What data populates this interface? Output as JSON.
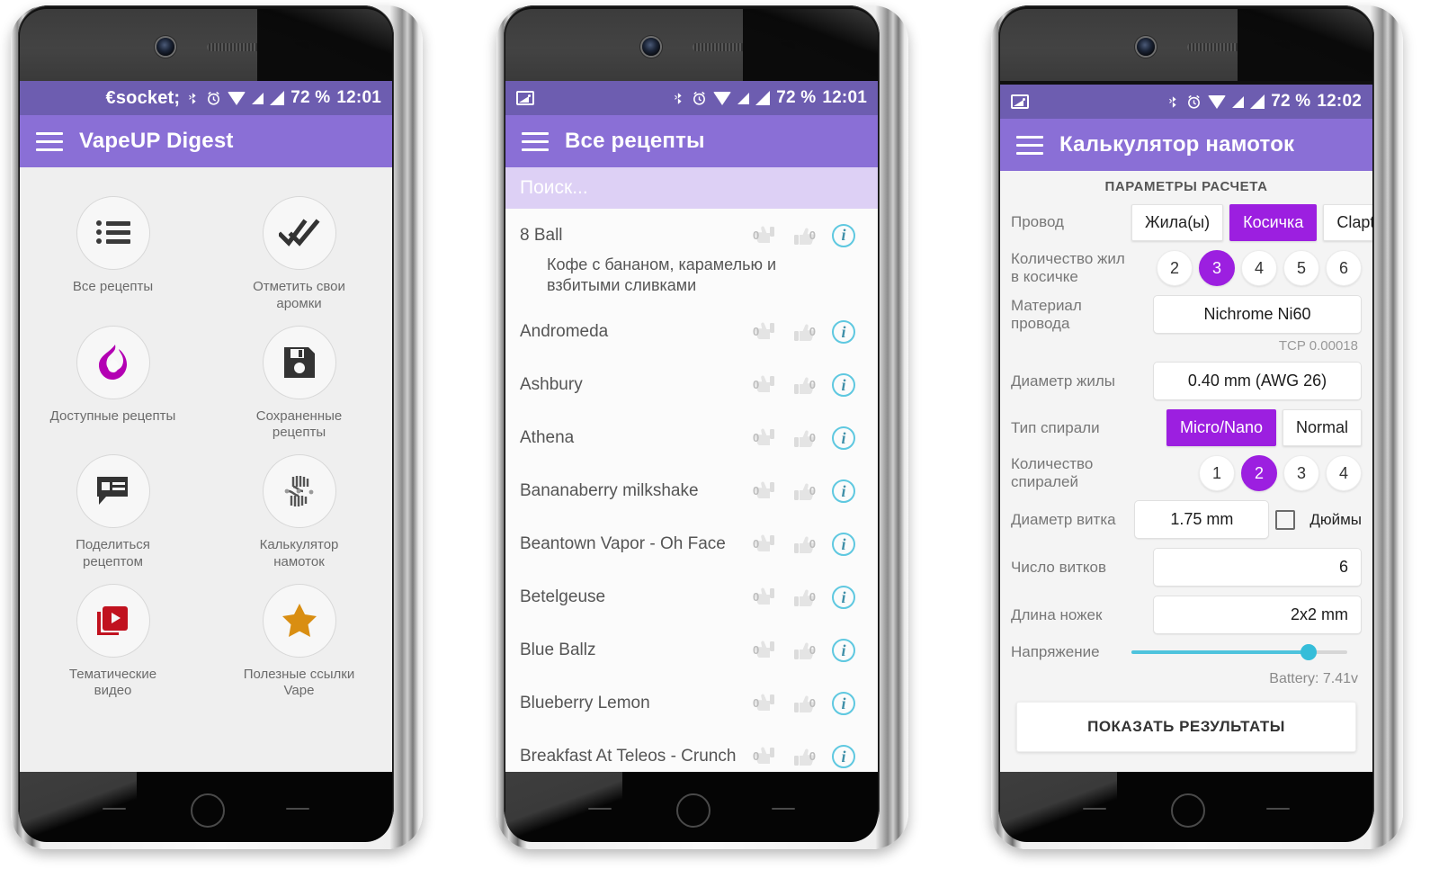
{
  "phones": {
    "p1": {
      "status": {
        "battery": "72 %",
        "time": "12:01",
        "icons": [
          "bluetooth-icon",
          "alarm-icon",
          "wifi-icon",
          "signal-icon",
          "signal-icon"
        ]
      },
      "appbar": {
        "title": "VapeUP Digest",
        "menu_icon": "hamburger-icon"
      },
      "grid": [
        {
          "icon": "list-icon",
          "label": "Все рецепты"
        },
        {
          "icon": "double-check-icon",
          "label": "Отметить свои аромки"
        },
        {
          "icon": "flame-icon",
          "label": "Доступные рецепты"
        },
        {
          "icon": "floppy-save-icon",
          "label": "Сохраненные рецепты"
        },
        {
          "icon": "share-comment-icon",
          "label": "Поделиться рецептом"
        },
        {
          "icon": "coil-calculator-icon",
          "label": "Калькулятор намоток"
        },
        {
          "icon": "video-library-icon",
          "label": "Тематические видео"
        },
        {
          "icon": "star-icon",
          "label": "Полезные ссылки Vape"
        }
      ]
    },
    "p2": {
      "status": {
        "battery": "72 %",
        "time": "12:01",
        "photo_icon": "photo-icon"
      },
      "appbar": {
        "title": "Все рецепты",
        "menu_icon": "hamburger-icon"
      },
      "search": {
        "placeholder": "Поиск..."
      },
      "items": [
        {
          "name": "8 Ball",
          "desc": "Кофе с бананом, карамелью и взбитыми сливками",
          "down": "0",
          "up": "0",
          "info": "i"
        },
        {
          "name": "Andromeda",
          "desc": "",
          "down": "0",
          "up": "0",
          "info": "i"
        },
        {
          "name": "Ashbury",
          "desc": "",
          "down": "0",
          "up": "0",
          "info": "i"
        },
        {
          "name": "Athena",
          "desc": "",
          "down": "0",
          "up": "0",
          "info": "i"
        },
        {
          "name": "Bananaberry milkshake",
          "desc": "",
          "down": "0",
          "up": "0",
          "info": "i"
        },
        {
          "name": "Beantown Vapor - Oh Face",
          "desc": "",
          "down": "0",
          "up": "0",
          "info": "i"
        },
        {
          "name": "Betelgeuse",
          "desc": "",
          "down": "0",
          "up": "0",
          "info": "i"
        },
        {
          "name": "Blue Ballz",
          "desc": "",
          "down": "0",
          "up": "0",
          "info": "i"
        },
        {
          "name": "Blueberry Lemon",
          "desc": "",
          "down": "0",
          "up": "0",
          "info": "i"
        },
        {
          "name": "Breakfast At Teleos - Crunch",
          "desc": "",
          "down": "0",
          "up": "0",
          "info": "i"
        }
      ]
    },
    "p3": {
      "status": {
        "battery": "72 %",
        "time": "12:02",
        "photo_icon": "photo-icon"
      },
      "appbar": {
        "title": "Калькулятор намоток",
        "menu_icon": "hamburger-icon"
      },
      "section_title": "ПАРАМЕТРЫ РАСЧЕТА",
      "rows": {
        "wire": {
          "label": "Провод",
          "options": [
            "Жила(ы)",
            "Косичка",
            "Clapton"
          ],
          "selected": "Косичка"
        },
        "strands": {
          "label": "Количество жил в косичке",
          "options": [
            "2",
            "3",
            "4",
            "5",
            "6"
          ],
          "selected": "3"
        },
        "material": {
          "label": "Материал провода",
          "value": "Nichrome Ni60",
          "tcp": "TCP 0.00018"
        },
        "diameter": {
          "label": "Диаметр жилы",
          "value": "0.40 mm (AWG 26)"
        },
        "coil_type": {
          "label": "Тип спирали",
          "options": [
            "Micro/Nano",
            "Normal"
          ],
          "selected": "Micro/Nano"
        },
        "coil_count": {
          "label": "Количество спиралей",
          "options": [
            "1",
            "2",
            "3",
            "4"
          ],
          "selected": "2"
        },
        "turn_diameter": {
          "label": "Диаметр витка",
          "value": "1.75 mm",
          "checkbox_label": "Дюймы",
          "checked": false
        },
        "turns": {
          "label": "Число витков",
          "value": "6"
        },
        "legs": {
          "label": "Длина ножек",
          "value": "2x2 mm"
        },
        "voltage": {
          "label": "Напряжение",
          "battery": "Battery: 7.41v",
          "percent": 82
        }
      },
      "cta": "ПОКАЗАТЬ РЕЗУЛЬТАТЫ"
    }
  },
  "colors": {
    "statusbar": "#6d5db0",
    "appbar": "#8a6fd6",
    "accent": "#9c1fe0",
    "search": "#ddd0f5",
    "slider": "#4ec3dd"
  }
}
